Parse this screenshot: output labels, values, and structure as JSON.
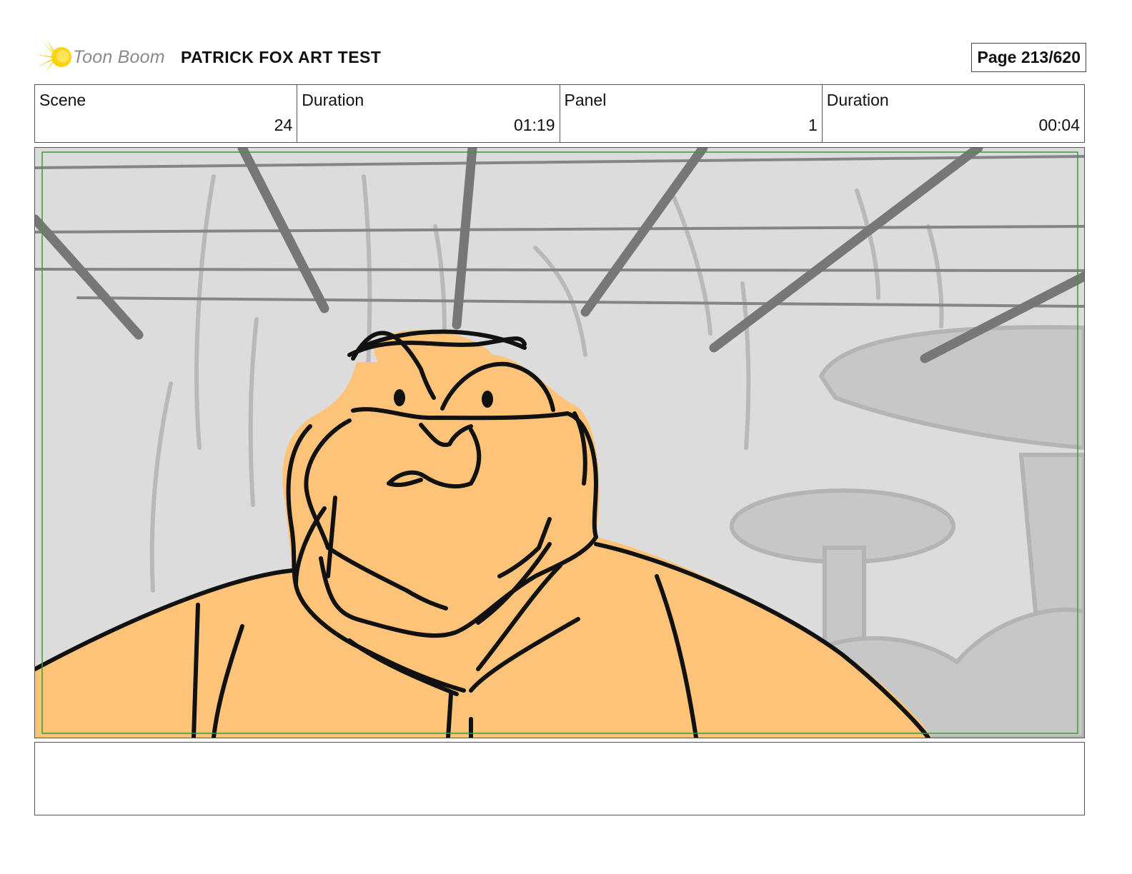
{
  "header": {
    "logo_text": "Toon Boom",
    "title": "PATRICK FOX ART TEST",
    "page_label": "Page 213/620"
  },
  "info": [
    {
      "label": "Scene",
      "value": "24"
    },
    {
      "label": "Duration",
      "value": "01:19"
    },
    {
      "label": "Panel",
      "value": "1"
    },
    {
      "label": "Duration",
      "value": "00:04"
    }
  ],
  "notes": {
    "text": ""
  },
  "colors": {
    "skin": "#fdc479",
    "background": "#dcdcdc",
    "safe_frame": "#3c9a3c",
    "logo_accent": "#f5c400"
  }
}
